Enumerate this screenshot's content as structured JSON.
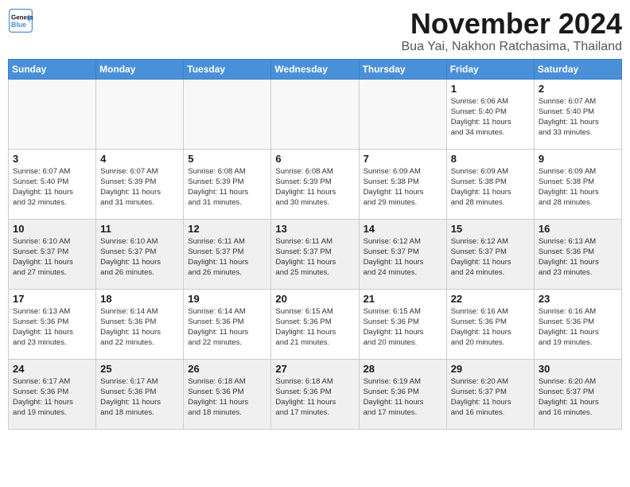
{
  "header": {
    "logo_line1": "General",
    "logo_line2": "Blue",
    "month": "November 2024",
    "location": "Bua Yai, Nakhon Ratchasima, Thailand"
  },
  "weekdays": [
    "Sunday",
    "Monday",
    "Tuesday",
    "Wednesday",
    "Thursday",
    "Friday",
    "Saturday"
  ],
  "weeks": [
    [
      {
        "day": "",
        "info": ""
      },
      {
        "day": "",
        "info": ""
      },
      {
        "day": "",
        "info": ""
      },
      {
        "day": "",
        "info": ""
      },
      {
        "day": "",
        "info": ""
      },
      {
        "day": "1",
        "info": "Sunrise: 6:06 AM\nSunset: 5:40 PM\nDaylight: 11 hours\nand 34 minutes."
      },
      {
        "day": "2",
        "info": "Sunrise: 6:07 AM\nSunset: 5:40 PM\nDaylight: 11 hours\nand 33 minutes."
      }
    ],
    [
      {
        "day": "3",
        "info": "Sunrise: 6:07 AM\nSunset: 5:40 PM\nDaylight: 11 hours\nand 32 minutes."
      },
      {
        "day": "4",
        "info": "Sunrise: 6:07 AM\nSunset: 5:39 PM\nDaylight: 11 hours\nand 31 minutes."
      },
      {
        "day": "5",
        "info": "Sunrise: 6:08 AM\nSunset: 5:39 PM\nDaylight: 11 hours\nand 31 minutes."
      },
      {
        "day": "6",
        "info": "Sunrise: 6:08 AM\nSunset: 5:39 PM\nDaylight: 11 hours\nand 30 minutes."
      },
      {
        "day": "7",
        "info": "Sunrise: 6:09 AM\nSunset: 5:38 PM\nDaylight: 11 hours\nand 29 minutes."
      },
      {
        "day": "8",
        "info": "Sunrise: 6:09 AM\nSunset: 5:38 PM\nDaylight: 11 hours\nand 28 minutes."
      },
      {
        "day": "9",
        "info": "Sunrise: 6:09 AM\nSunset: 5:38 PM\nDaylight: 11 hours\nand 28 minutes."
      }
    ],
    [
      {
        "day": "10",
        "info": "Sunrise: 6:10 AM\nSunset: 5:37 PM\nDaylight: 11 hours\nand 27 minutes."
      },
      {
        "day": "11",
        "info": "Sunrise: 6:10 AM\nSunset: 5:37 PM\nDaylight: 11 hours\nand 26 minutes."
      },
      {
        "day": "12",
        "info": "Sunrise: 6:11 AM\nSunset: 5:37 PM\nDaylight: 11 hours\nand 26 minutes."
      },
      {
        "day": "13",
        "info": "Sunrise: 6:11 AM\nSunset: 5:37 PM\nDaylight: 11 hours\nand 25 minutes."
      },
      {
        "day": "14",
        "info": "Sunrise: 6:12 AM\nSunset: 5:37 PM\nDaylight: 11 hours\nand 24 minutes."
      },
      {
        "day": "15",
        "info": "Sunrise: 6:12 AM\nSunset: 5:37 PM\nDaylight: 11 hours\nand 24 minutes."
      },
      {
        "day": "16",
        "info": "Sunrise: 6:13 AM\nSunset: 5:36 PM\nDaylight: 11 hours\nand 23 minutes."
      }
    ],
    [
      {
        "day": "17",
        "info": "Sunrise: 6:13 AM\nSunset: 5:36 PM\nDaylight: 11 hours\nand 23 minutes."
      },
      {
        "day": "18",
        "info": "Sunrise: 6:14 AM\nSunset: 5:36 PM\nDaylight: 11 hours\nand 22 minutes."
      },
      {
        "day": "19",
        "info": "Sunrise: 6:14 AM\nSunset: 5:36 PM\nDaylight: 11 hours\nand 22 minutes."
      },
      {
        "day": "20",
        "info": "Sunrise: 6:15 AM\nSunset: 5:36 PM\nDaylight: 11 hours\nand 21 minutes."
      },
      {
        "day": "21",
        "info": "Sunrise: 6:15 AM\nSunset: 5:36 PM\nDaylight: 11 hours\nand 20 minutes."
      },
      {
        "day": "22",
        "info": "Sunrise: 6:16 AM\nSunset: 5:36 PM\nDaylight: 11 hours\nand 20 minutes."
      },
      {
        "day": "23",
        "info": "Sunrise: 6:16 AM\nSunset: 5:36 PM\nDaylight: 11 hours\nand 19 minutes."
      }
    ],
    [
      {
        "day": "24",
        "info": "Sunrise: 6:17 AM\nSunset: 5:36 PM\nDaylight: 11 hours\nand 19 minutes."
      },
      {
        "day": "25",
        "info": "Sunrise: 6:17 AM\nSunset: 5:36 PM\nDaylight: 11 hours\nand 18 minutes."
      },
      {
        "day": "26",
        "info": "Sunrise: 6:18 AM\nSunset: 5:36 PM\nDaylight: 11 hours\nand 18 minutes."
      },
      {
        "day": "27",
        "info": "Sunrise: 6:18 AM\nSunset: 5:36 PM\nDaylight: 11 hours\nand 17 minutes."
      },
      {
        "day": "28",
        "info": "Sunrise: 6:19 AM\nSunset: 5:36 PM\nDaylight: 11 hours\nand 17 minutes."
      },
      {
        "day": "29",
        "info": "Sunrise: 6:20 AM\nSunset: 5:37 PM\nDaylight: 11 hours\nand 16 minutes."
      },
      {
        "day": "30",
        "info": "Sunrise: 6:20 AM\nSunset: 5:37 PM\nDaylight: 11 hours\nand 16 minutes."
      }
    ]
  ]
}
